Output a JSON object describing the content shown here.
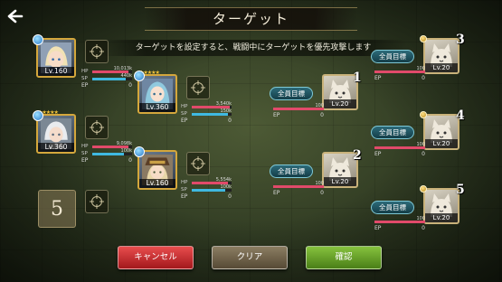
{
  "header": {
    "title": "ターゲット",
    "instruction": "ターゲットを設定すると、戦闘中にターゲットを優先攻撃します"
  },
  "icons": {
    "back": "back-arrow-icon",
    "crosshair": "crosshair-icon",
    "element": "element-orb-icon",
    "gem": "gem-icon"
  },
  "allies": [
    {
      "level": "Lv.160",
      "hp": "10,013k",
      "sp": "440k",
      "ep_label": "EP",
      "ep": "0",
      "hp_label": "HP",
      "sp_label": "SP",
      "hp_ratio": 0.92,
      "sp_ratio": 0.85
    },
    {
      "level": "Lv.360",
      "hp": "3,540k",
      "sp": "150k",
      "ep_label": "EP",
      "ep": "0",
      "hp_label": "HP",
      "sp_label": "SP",
      "hp_ratio": 0.95,
      "sp_ratio": 0.9,
      "stars": "★★★★★"
    },
    {
      "level": "Lv.360",
      "hp": "9,098k",
      "sp": "100k",
      "ep_label": "EP",
      "ep": "0",
      "hp_label": "HP",
      "sp_label": "SP",
      "hp_ratio": 0.9,
      "sp_ratio": 0.8,
      "stars": "★★★★★"
    },
    {
      "level": "Lv.160",
      "hp": "5,554k",
      "sp": "100k",
      "ep_label": "EP",
      "ep": "0",
      "hp_label": "HP",
      "sp_label": "SP",
      "hp_ratio": 0.92,
      "sp_ratio": 0.85
    },
    {
      "slot_number": "5"
    }
  ],
  "enemies": [
    {
      "number": "1",
      "target_label": "全員目標",
      "level": "Lv.20",
      "hp": "100",
      "ep_label": "EP",
      "ep": "0",
      "hp_ratio": 1.0
    },
    {
      "number": "2",
      "target_label": "全員目標",
      "level": "Lv.20",
      "hp": "100",
      "ep_label": "EP",
      "ep": "0",
      "hp_ratio": 1.0
    },
    {
      "number": "3",
      "target_label": "全員目標",
      "level": "Lv.20",
      "hp": "100",
      "ep_label": "EP",
      "ep": "0",
      "hp_ratio": 1.0
    },
    {
      "number": "4",
      "target_label": "全員目標",
      "level": "Lv.20",
      "hp": "100",
      "ep_label": "EP",
      "ep": "0",
      "hp_ratio": 1.0
    },
    {
      "number": "5",
      "target_label": "全員目標",
      "level": "Lv.20",
      "hp": "100",
      "ep_label": "EP",
      "ep": "0",
      "hp_ratio": 1.0
    }
  ],
  "buttons": {
    "cancel": "キャンセル",
    "clear": "クリア",
    "confirm": "確認"
  },
  "colors": {
    "cancel": "#c92b2f",
    "clear": "#6e6248",
    "confirm": "#5f9a26",
    "hp_bar": "#e14a6a",
    "sp_bar": "#3fb9e0",
    "frame": "#d4a73c"
  }
}
